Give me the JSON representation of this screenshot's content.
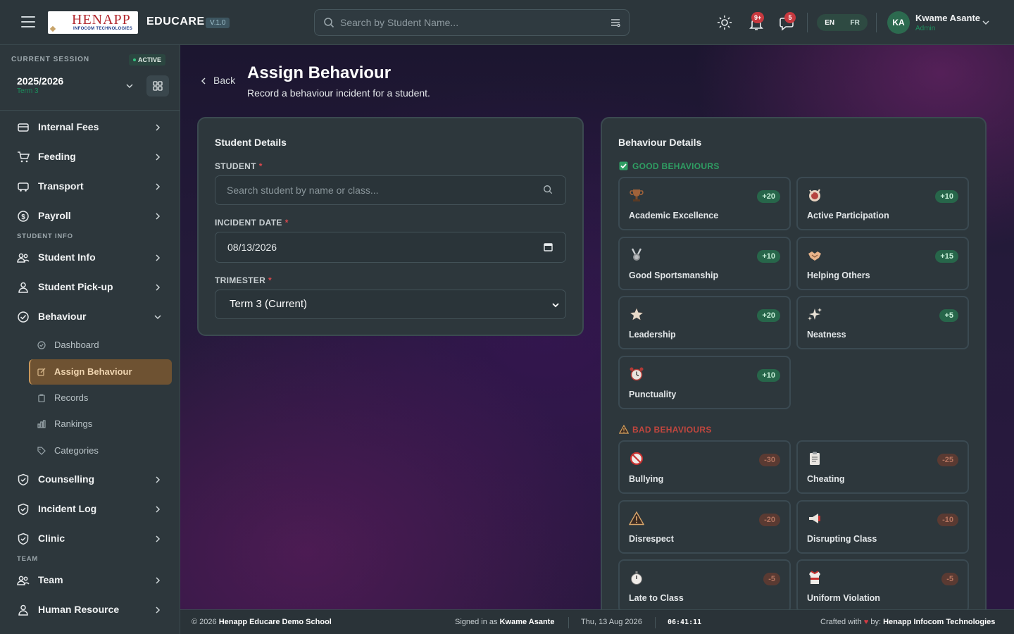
{
  "header": {
    "logo_text": "HENAPP",
    "logo_subtext": "INFOCOM TECHNOLOGIES",
    "brand": "EDUCARE",
    "version": "V.1.0",
    "search_placeholder": "Search by Student Name...",
    "notifications_badge": "9+",
    "messages_badge": "5",
    "lang_en": "EN",
    "lang_fr": "FR",
    "user_initials": "KA",
    "user_name": "Kwame Asante",
    "user_role": "Admin"
  },
  "session": {
    "label": "CURRENT SESSION",
    "status": "ACTIVE",
    "year": "2025/2026",
    "term": "Term 3"
  },
  "sidebar": {
    "items": [
      {
        "label": "Internal Fees",
        "icon": "fees-icon"
      },
      {
        "label": "Feeding",
        "icon": "cart-icon"
      },
      {
        "label": "Transport",
        "icon": "bus-icon"
      },
      {
        "label": "Payroll",
        "icon": "dollar-icon"
      }
    ],
    "section_student_info": "STUDENT INFO",
    "student_items": [
      {
        "label": "Student Info",
        "icon": "users-icon"
      },
      {
        "label": "Student Pick-up",
        "icon": "user-icon"
      },
      {
        "label": "Behaviour",
        "icon": "check-circle-icon"
      }
    ],
    "behaviour_sub": [
      {
        "label": "Dashboard"
      },
      {
        "label": "Assign Behaviour"
      },
      {
        "label": "Records"
      },
      {
        "label": "Rankings"
      },
      {
        "label": "Categories"
      }
    ],
    "more_items": [
      {
        "label": "Counselling",
        "icon": "shield-icon"
      },
      {
        "label": "Incident Log",
        "icon": "shield-icon"
      },
      {
        "label": "Clinic",
        "icon": "shield-icon"
      }
    ],
    "section_team": "TEAM",
    "team_items": [
      {
        "label": "Team",
        "icon": "users-icon"
      },
      {
        "label": "Human Resource",
        "icon": "user-icon"
      }
    ]
  },
  "page": {
    "back_label": "Back",
    "title": "Assign Behaviour",
    "subtitle": "Record a behaviour incident for a student."
  },
  "student_details": {
    "title": "Student Details",
    "student_label": "STUDENT",
    "student_placeholder": "Search student by name or class...",
    "date_label": "INCIDENT DATE",
    "date_value": "08/13/2026",
    "trimester_label": "TRIMESTER",
    "trimester_value": "Term 3 (Current)",
    "required_mark": "*"
  },
  "behaviour_details": {
    "title": "Behaviour Details",
    "good_heading": "GOOD BEHAVIOURS",
    "bad_heading": "BAD BEHAVIOURS",
    "good": [
      {
        "name": "Academic Excellence",
        "points": "+20",
        "icon": "trophy-icon"
      },
      {
        "name": "Active Participation",
        "points": "+10",
        "icon": "raised-hand-icon"
      },
      {
        "name": "Good Sportsmanship",
        "points": "+10",
        "icon": "medal-icon"
      },
      {
        "name": "Helping Others",
        "points": "+15",
        "icon": "handshake-icon"
      },
      {
        "name": "Leadership",
        "points": "+20",
        "icon": "star-icon"
      },
      {
        "name": "Neatness",
        "points": "+5",
        "icon": "sparkles-icon"
      },
      {
        "name": "Punctuality",
        "points": "+10",
        "icon": "alarm-clock-icon"
      }
    ],
    "bad": [
      {
        "name": "Bullying",
        "points": "-30",
        "icon": "prohibited-icon"
      },
      {
        "name": "Cheating",
        "points": "-25",
        "icon": "clipboard-icon"
      },
      {
        "name": "Disrespect",
        "points": "-20",
        "icon": "warning-icon"
      },
      {
        "name": "Disrupting Class",
        "points": "-10",
        "icon": "megaphone-icon"
      },
      {
        "name": "Late to Class",
        "points": "-5",
        "icon": "stopwatch-icon"
      },
      {
        "name": "Uniform Violation",
        "points": "-5",
        "icon": "shirt-icon"
      }
    ]
  },
  "footer": {
    "copyright": "© 2026",
    "school": "Henapp Educare Demo School",
    "signed_in_prefix": "Signed in as",
    "signed_in_user": "Kwame Asante",
    "date": "Thu, 13 Aug 2026",
    "time": "06:41:11",
    "crafted_prefix": "Crafted with",
    "heart": "♥",
    "crafted_by": "by:",
    "company": "Henapp Infocom Technologies"
  },
  "colors": {
    "good": "#2f9e63",
    "bad": "#c0463e",
    "accent_active": "#6e5232"
  }
}
